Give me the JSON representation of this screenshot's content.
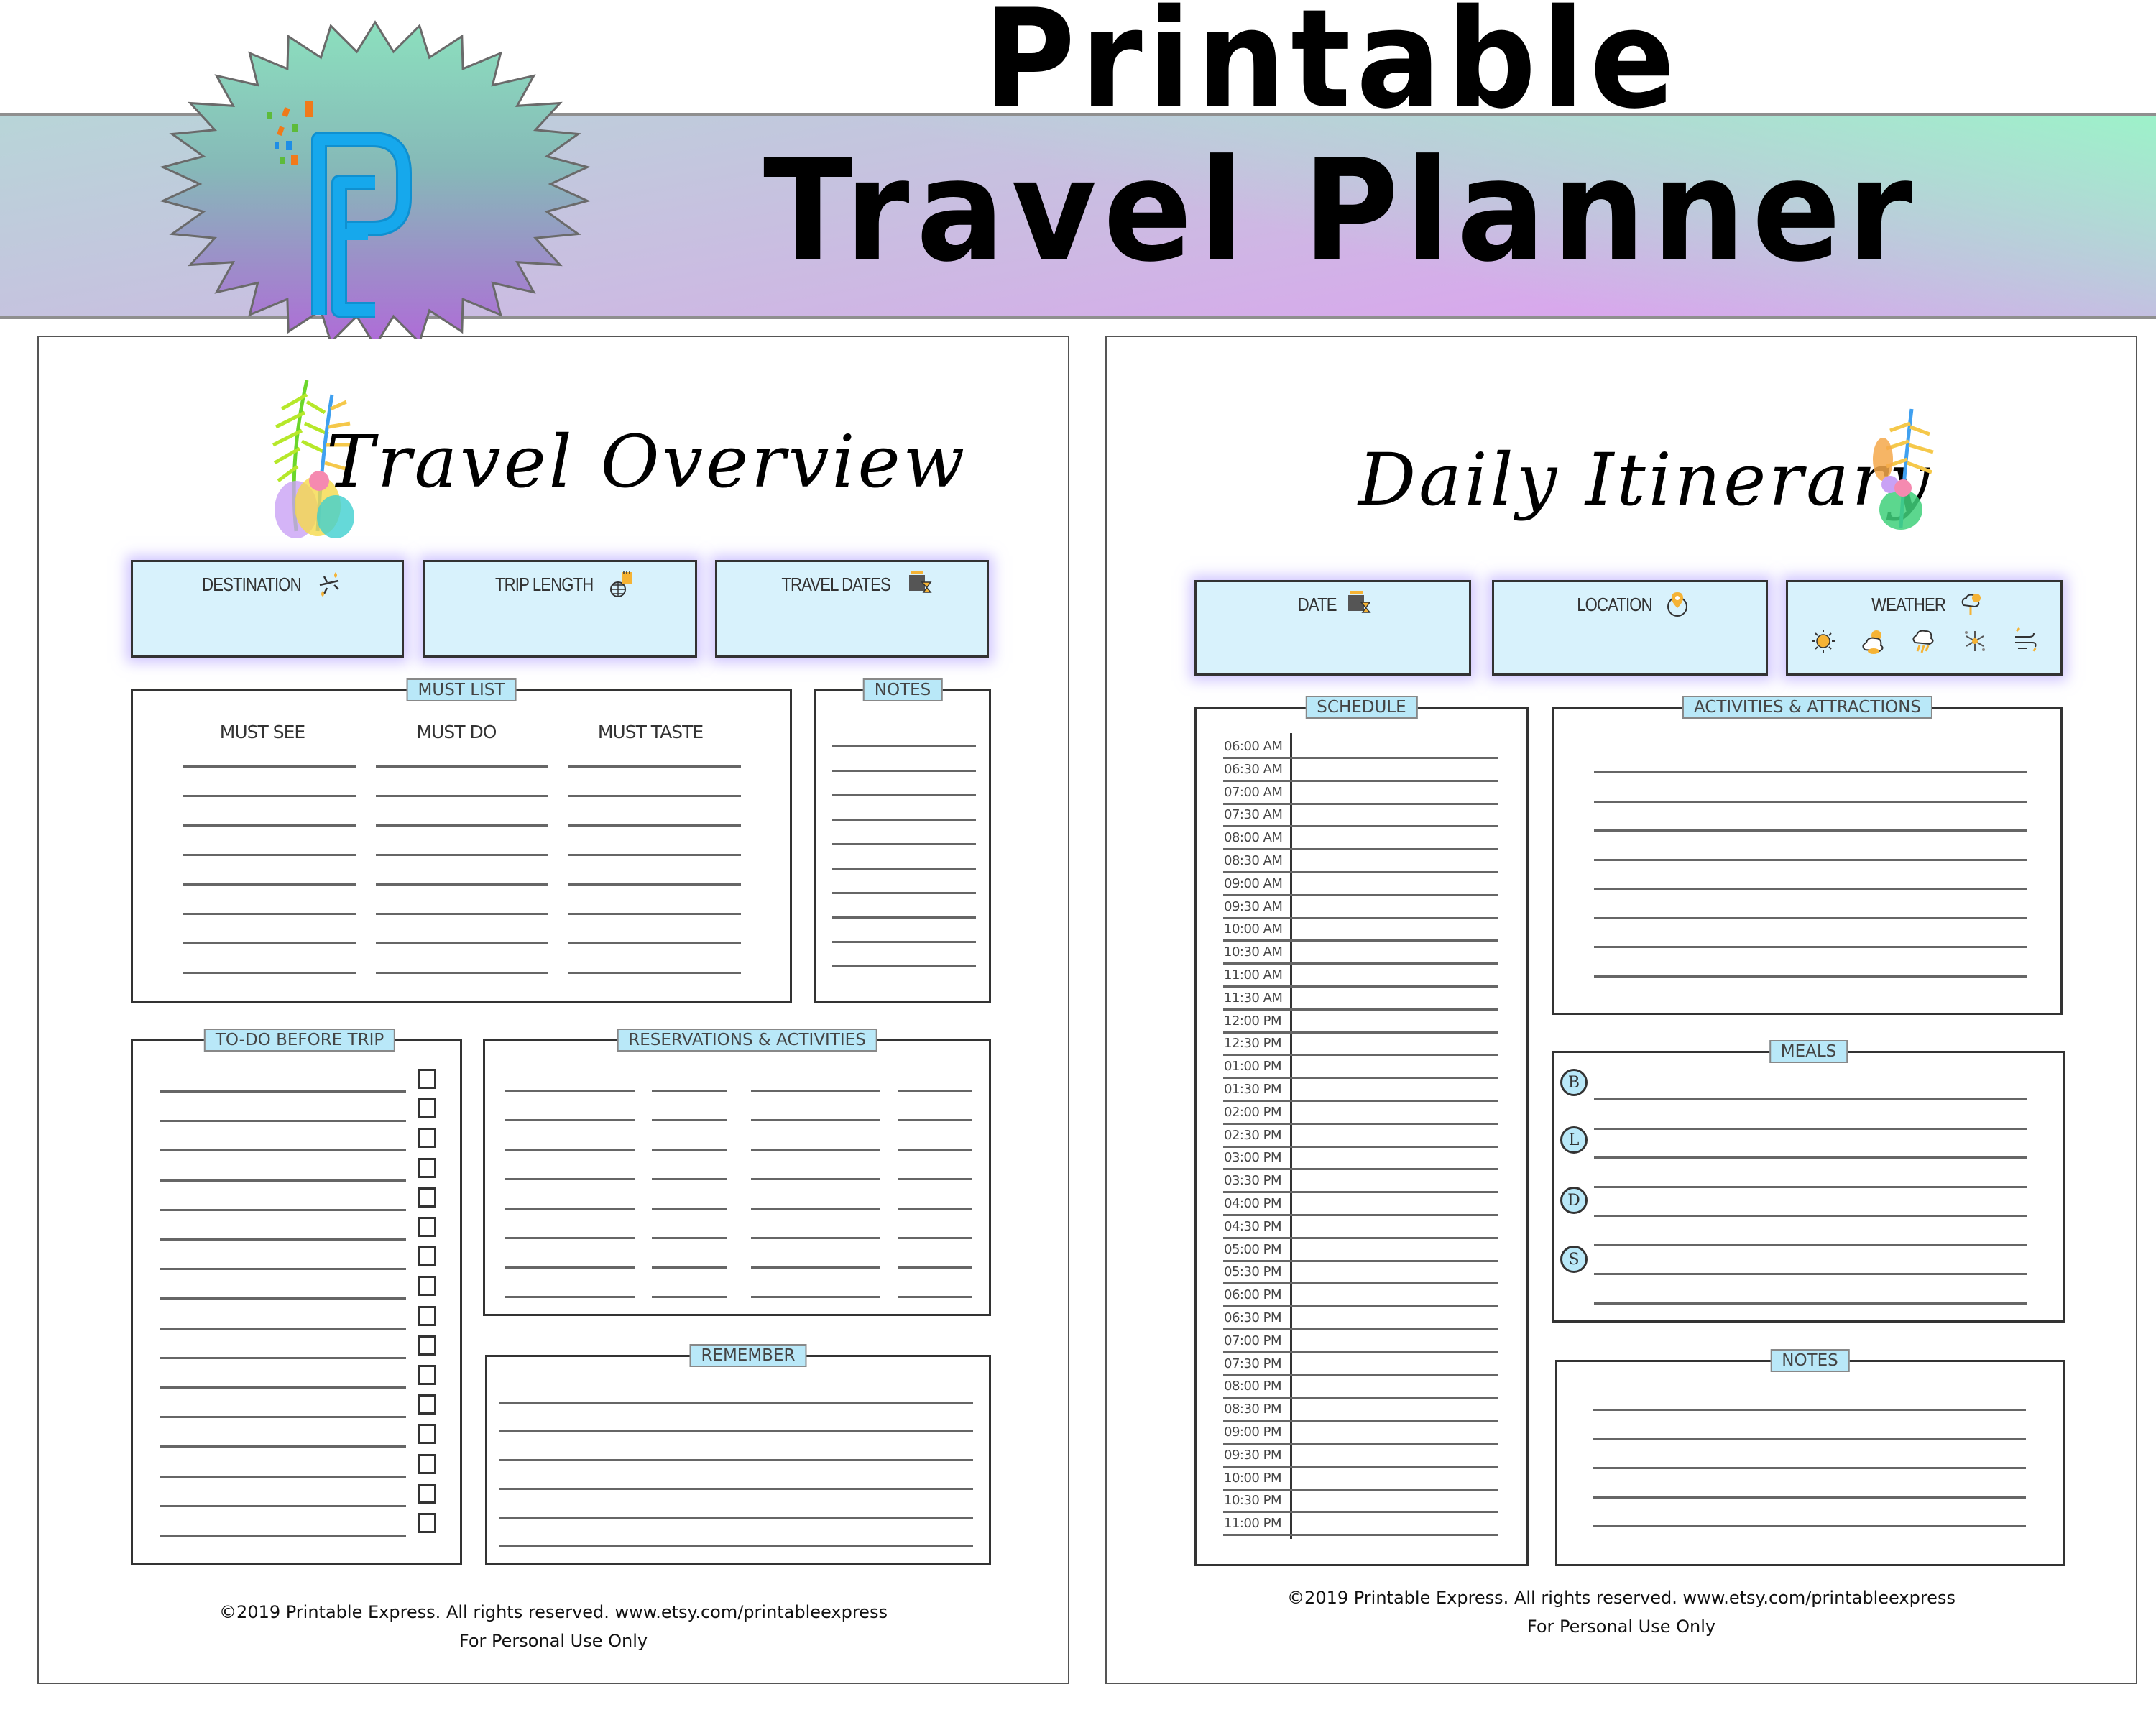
{
  "header": {
    "title_line1": "Printable",
    "title_line2": "Travel Planner",
    "logo_letters": "PE",
    "colors": {
      "banner_top": "#9af5c8",
      "banner_bottom": "#e09cf3",
      "logo_blue": "#16a8ec",
      "starburst_top": "#8ce0be",
      "starburst_bottom": "#b06ad8"
    }
  },
  "travel_overview": {
    "title": "Travel Overview",
    "info_boxes": [
      {
        "label": "DESTINATION",
        "icon": "plane-icon"
      },
      {
        "label": "TRIP LENGTH",
        "icon": "globe-calendar-icon"
      },
      {
        "label": "TRAVEL DATES",
        "icon": "calendar-hourglass-icon"
      }
    ],
    "must_list": {
      "tab": "MUST LIST",
      "columns": [
        "MUST SEE",
        "MUST DO",
        "MUST TASTE"
      ],
      "rows": 8
    },
    "notes": {
      "tab": "NOTES",
      "rows": 10
    },
    "todo": {
      "tab": "TO-DO BEFORE TRIP",
      "rows": 16
    },
    "reservations": {
      "tab": "RESERVATIONS & ACTIVITIES",
      "columns": 4,
      "rows": 8
    },
    "remember": {
      "tab": "REMEMBER",
      "rows": 6
    },
    "footer_line1": "©2019 Printable Express.  All rights reserved. www.etsy.com/printableexpress",
    "footer_line2": "For Personal Use Only"
  },
  "daily_itinerary": {
    "title": "Daily Itinerary",
    "info_boxes": [
      {
        "label": "DATE",
        "icon": "calendar-hourglass-icon"
      },
      {
        "label": "LOCATION",
        "icon": "globe-pin-icon"
      },
      {
        "label": "WEATHER",
        "icon": "weather-icon"
      }
    ],
    "weather_options": [
      "sunny-icon",
      "partly-cloudy-icon",
      "thunderstorm-icon",
      "snow-icon",
      "windy-icon"
    ],
    "schedule": {
      "tab": "SCHEDULE",
      "times": [
        "06:00 AM",
        "06:30 AM",
        "07:00 AM",
        "07:30 AM",
        "08:00 AM",
        "08:30 AM",
        "09:00 AM",
        "09:30 AM",
        "10:00 AM",
        "10:30 AM",
        "11:00 AM",
        "11:30 AM",
        "12:00 PM",
        "12:30 PM",
        "01:00 PM",
        "01:30 PM",
        "02:00 PM",
        "02:30 PM",
        "03:00 PM",
        "03:30 PM",
        "04:00 PM",
        "04:30 PM",
        "05:00 PM",
        "05:30 PM",
        "06:00 PM",
        "06:30 PM",
        "07:00 PM",
        "07:30 PM",
        "08:00 PM",
        "08:30 PM",
        "09:00 PM",
        "09:30 PM",
        "10:00 PM",
        "10:30 PM",
        "11:00 PM"
      ]
    },
    "activities": {
      "tab": "ACTIVITIES & ATTRACTIONS",
      "rows": 8
    },
    "meals": {
      "tab": "MEALS",
      "badges": [
        "B",
        "L",
        "D",
        "S"
      ],
      "rows": 8
    },
    "notes": {
      "tab": "NOTES",
      "rows": 5
    },
    "footer_line1": "©2019 Printable Express.  All rights reserved. www.etsy.com/printableexpress",
    "footer_line2": "For Personal Use Only"
  }
}
